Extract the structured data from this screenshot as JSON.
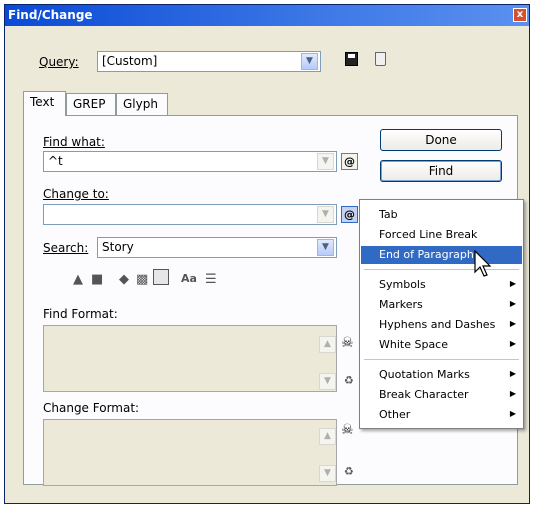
{
  "window": {
    "title": "Find/Change",
    "close_glyph": "x"
  },
  "query": {
    "label": "Query:",
    "value": "[Custom]"
  },
  "tabs": [
    {
      "label": "Text"
    },
    {
      "label": "GREP"
    },
    {
      "label": "Glyph"
    }
  ],
  "find_what": {
    "label": "Find what:",
    "value": "^t"
  },
  "change_to": {
    "label": "Change to:",
    "value": ""
  },
  "search": {
    "label": "Search:",
    "value": "Story"
  },
  "buttons": {
    "done": "Done",
    "find": "Find"
  },
  "option_icons": {
    "case_label": "Aa"
  },
  "find_format": {
    "label": "Find Format:"
  },
  "change_format": {
    "label": "Change Format:"
  },
  "menu": {
    "items": [
      {
        "label": "Tab",
        "submenu": false
      },
      {
        "label": "Forced Line Break",
        "submenu": false
      },
      {
        "label": "End of Paragraph",
        "submenu": false,
        "selected": true
      },
      {
        "label": "Symbols",
        "submenu": true
      },
      {
        "label": "Markers",
        "submenu": true
      },
      {
        "label": "Hyphens and Dashes",
        "submenu": true
      },
      {
        "label": "White Space",
        "submenu": true
      },
      {
        "label": "Quotation Marks",
        "submenu": true
      },
      {
        "label": "Break Character",
        "submenu": true
      },
      {
        "label": "Other",
        "submenu": true
      }
    ]
  },
  "colors": {
    "title_bar": "#0a4ad6",
    "menu_highlight": "#316ac5",
    "dialog_bg": "#ece9d8"
  }
}
